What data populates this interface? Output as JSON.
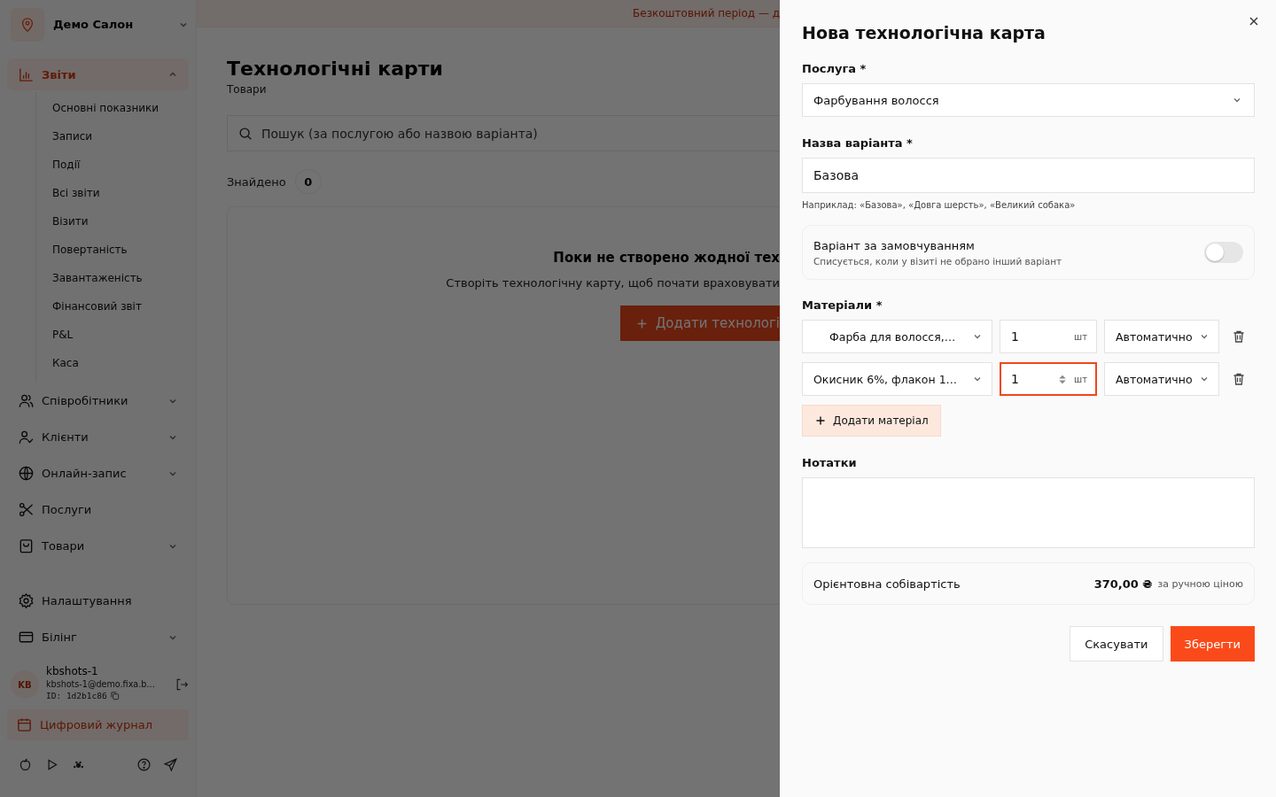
{
  "sidebar": {
    "salon": "Демо Салон",
    "nav": [
      {
        "label": "Звіти",
        "kind": "group",
        "expanded": true,
        "selected": true,
        "children": [
          {
            "label": "Основні показники",
            "selected": false
          },
          {
            "label": "Записи",
            "selected": false
          },
          {
            "label": "Події",
            "selected": false
          },
          {
            "label": "Всі звіти",
            "selected": false
          },
          {
            "label": "Візити",
            "selected": false
          },
          {
            "label": "Повертаність",
            "selected": false
          },
          {
            "label": "Завантаженість",
            "selected": false
          },
          {
            "label": "Фінансовий звіт",
            "selected": false
          },
          {
            "label": "P&L",
            "selected": false
          },
          {
            "label": "Каса",
            "selected": false
          }
        ]
      },
      {
        "label": "Співробітники",
        "kind": "group",
        "expanded": false,
        "selected": false
      },
      {
        "label": "Клієнти",
        "kind": "group",
        "expanded": false,
        "selected": false
      },
      {
        "label": "Онлайн-запис",
        "kind": "group",
        "expanded": false,
        "selected": false
      },
      {
        "label": "Послуги",
        "kind": "link",
        "selected": false
      },
      {
        "label": "Товари",
        "kind": "group",
        "expanded": false,
        "selected": false
      }
    ],
    "footer_nav": [
      {
        "label": "Налаштування",
        "kind": "link",
        "selected": false
      },
      {
        "label": "Білінг",
        "kind": "group",
        "expanded": false,
        "selected": false
      }
    ],
    "user": {
      "initials": "KB",
      "name": "kbshots-1",
      "email": "kbshots-1@demo.fixa.b…",
      "id": "ID: 1d2b1c86"
    },
    "journal_button": "Цифровий журнал"
  },
  "banner": "Безкоштовний період — д",
  "page": {
    "title": "Технологічні карти",
    "subtitle": "Товари",
    "search": {
      "placeholder": "Пошук (за послугою або назвою варіанта)"
    },
    "found_label": "Знайдено",
    "found_count": "0",
    "empty": {
      "title": "Поки не створено жодної тех",
      "text": "Створіть технологічну карту, щоб почати враховувати",
      "button": "Додати технологі"
    }
  },
  "drawer": {
    "title": "Нова технологічна карта",
    "service": {
      "label": "Послуга *",
      "value": "Фарбування волосся"
    },
    "variant": {
      "label": "Назва варіанта *",
      "value": "Базова",
      "hint": "Наприклад: «Базова», «Довга шерсть», «Великий собака»"
    },
    "default_variant": {
      "title": "Варіант за замовчуванням",
      "subtitle": "Списується, коли у візиті не обрано інший варіант",
      "on": false
    },
    "materials": {
      "label": "Матеріали *",
      "rows": [
        {
          "name": "Фарба для волосся,…",
          "quantity": "1",
          "unit": "шт",
          "mode": "Автоматично",
          "focused": false
        },
        {
          "name": "Окисник 6%, флакон 1…",
          "quantity": "1",
          "unit": "шт",
          "mode": "Автоматично",
          "focused": true
        }
      ],
      "add_button": "Додати матеріал"
    },
    "notes": {
      "label": "Нотатки"
    },
    "cost": {
      "label": "Орієнтовна собівартість",
      "value": "370,00 ₴",
      "note": "за ручною ціною"
    },
    "buttons": {
      "cancel": "Скасувати",
      "save": "Зберегти"
    }
  }
}
